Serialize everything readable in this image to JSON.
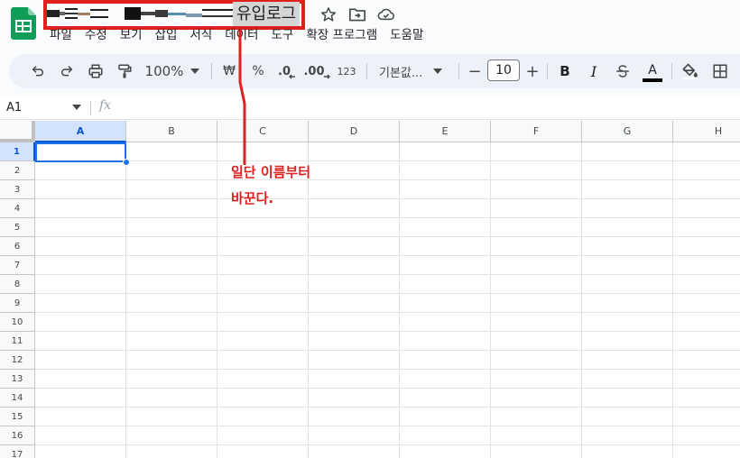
{
  "app": {
    "document_title": "유입로그",
    "accent_color": "#e01f1f",
    "selection_color": "#1a73e8"
  },
  "header_icons": [
    "star-icon",
    "move-to-folder-icon",
    "cloud-status-icon"
  ],
  "menu": {
    "items": [
      "파일",
      "수정",
      "보기",
      "삽입",
      "서식",
      "데이터",
      "도구",
      "확장 프로그램",
      "도움말"
    ]
  },
  "toolbar": {
    "zoom": "100%",
    "currency": "₩",
    "percent": "%",
    "decrease_decimal": ".0",
    "increase_decimal": ".00",
    "number_format": "123",
    "font_family": "기본값...",
    "minus": "−",
    "font_size": "10",
    "plus": "+",
    "bold": "B",
    "italic": "I",
    "text_color_letter": "A"
  },
  "formula_bar": {
    "cell_ref": "A1",
    "fx": "fx"
  },
  "grid": {
    "columns": [
      "A",
      "B",
      "C",
      "D",
      "E",
      "F",
      "G",
      "H"
    ],
    "rows": [
      "1",
      "2",
      "3",
      "4",
      "5",
      "6",
      "7",
      "8",
      "9",
      "10",
      "11",
      "12",
      "13",
      "14",
      "15",
      "16",
      "17"
    ],
    "selected_column": "A",
    "selected_row": "1"
  },
  "annotation": {
    "line1": "일단 이름부터",
    "line2": "바꾼다."
  }
}
